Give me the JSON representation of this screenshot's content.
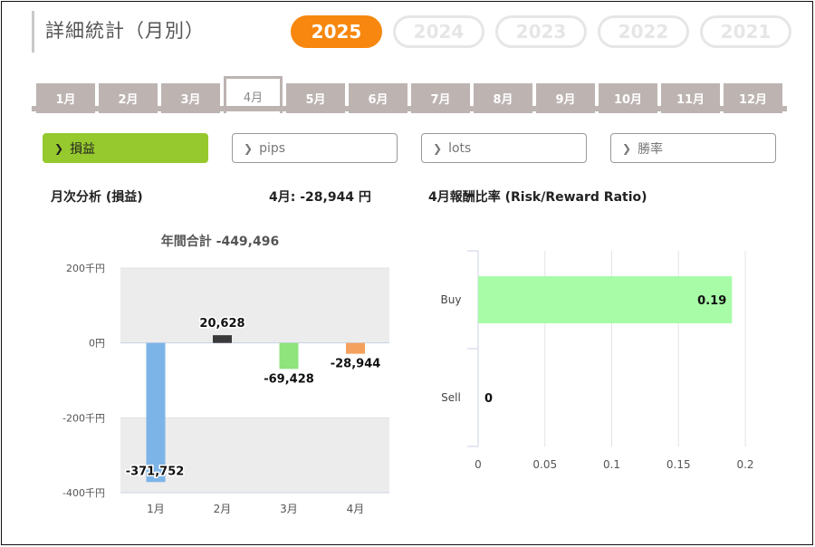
{
  "header": {
    "title": "詳細統計（月別）"
  },
  "years": [
    {
      "label": "2025",
      "active": true
    },
    {
      "label": "2024",
      "active": false
    },
    {
      "label": "2023",
      "active": false
    },
    {
      "label": "2022",
      "active": false
    },
    {
      "label": "2021",
      "active": false
    }
  ],
  "months": [
    {
      "label": "1月",
      "active": false
    },
    {
      "label": "2月",
      "active": false
    },
    {
      "label": "3月",
      "active": false
    },
    {
      "label": "4月",
      "active": true
    },
    {
      "label": "5月",
      "active": false
    },
    {
      "label": "6月",
      "active": false
    },
    {
      "label": "7月",
      "active": false
    },
    {
      "label": "8月",
      "active": false
    },
    {
      "label": "9月",
      "active": false
    },
    {
      "label": "10月",
      "active": false
    },
    {
      "label": "11月",
      "active": false
    },
    {
      "label": "12月",
      "active": false
    }
  ],
  "metrics": [
    {
      "label": "損益",
      "active": true
    },
    {
      "label": "pips",
      "active": false
    },
    {
      "label": "lots",
      "active": false
    },
    {
      "label": "勝率",
      "active": false
    }
  ],
  "summary": {
    "monthly_title": "月次分析 (損益)",
    "month_value": "4月:  -28,944 円",
    "ratio_title": "4月報酬比率 (Risk/Reward Ratio)"
  },
  "colors": {
    "accent": "#f7870e",
    "active_metric": "#96c92e",
    "tab_gray": "#bdb4b2"
  },
  "chart_data": [
    {
      "type": "bar",
      "title": "年間合計 -449,496",
      "categories": [
        "1月",
        "2月",
        "3月",
        "4月"
      ],
      "values": [
        -371752,
        20628,
        -69428,
        -28944
      ],
      "value_labels": [
        "-371,752",
        "20,628",
        "-69,428",
        "-28,944"
      ],
      "bar_colors": [
        "#7db4e8",
        "#3a3a3a",
        "#8fe47c",
        "#f5a15e"
      ],
      "yticks": [
        200,
        0,
        -200,
        -400
      ],
      "ytick_labels": [
        "200千円",
        "0円",
        "-200千円",
        "-400千円"
      ],
      "ylim": [
        -400000,
        200000
      ],
      "grid": true,
      "legend": "none"
    },
    {
      "type": "bar",
      "orientation": "horizontal",
      "categories": [
        "Buy",
        "Sell"
      ],
      "values": [
        0.19,
        0
      ],
      "value_labels": [
        "0.19",
        "0"
      ],
      "bar_color": "#a8fca8",
      "xticks": [
        0,
        0.05,
        0.1,
        0.15,
        0.2
      ],
      "xtick_labels": [
        "0",
        "0.05",
        "0.1",
        "0.15",
        "0.2"
      ],
      "xlim": [
        0,
        0.2
      ],
      "grid": true,
      "legend": "none"
    }
  ]
}
